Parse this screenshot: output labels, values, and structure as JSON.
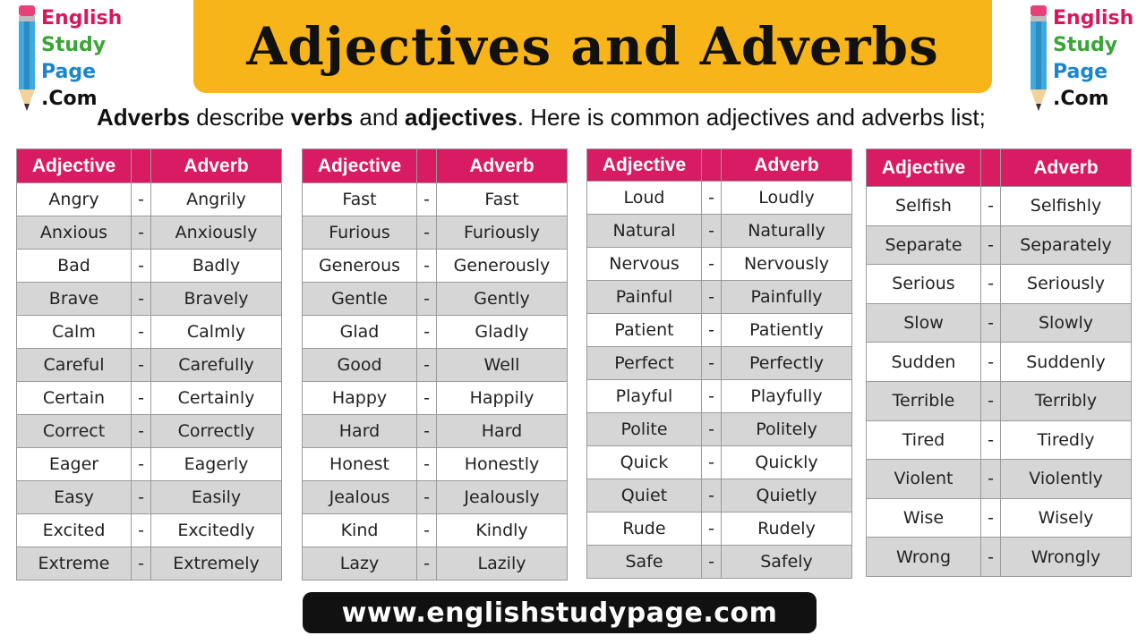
{
  "logo": {
    "line1": "English",
    "line2": "Study",
    "line3": "Page",
    "line4": ".Com"
  },
  "title": "Adjectives and Adverbs",
  "subtitle": {
    "w1": "Adverbs",
    "w2": " describe ",
    "w3": "verbs",
    "w4": " and ",
    "w5": "adjectives",
    "w6": ". Here is common adjectives and adverbs list;"
  },
  "headers": {
    "adjective": "Adjective",
    "adverb": "Adverb",
    "dash": "-"
  },
  "tables": [
    {
      "rows": [
        [
          "Angry",
          "Angrily"
        ],
        [
          "Anxious",
          "Anxiously"
        ],
        [
          "Bad",
          "Badly"
        ],
        [
          "Brave",
          "Bravely"
        ],
        [
          "Calm",
          "Calmly"
        ],
        [
          "Careful",
          "Carefully"
        ],
        [
          "Certain",
          "Certainly"
        ],
        [
          "Correct",
          "Correctly"
        ],
        [
          "Eager",
          "Eagerly"
        ],
        [
          "Easy",
          "Easily"
        ],
        [
          "Excited",
          "Excitedly"
        ],
        [
          "Extreme",
          "Extremely"
        ]
      ]
    },
    {
      "rows": [
        [
          "Fast",
          "Fast"
        ],
        [
          "Furious",
          "Furiously"
        ],
        [
          "Generous",
          "Generously"
        ],
        [
          "Gentle",
          "Gently"
        ],
        [
          "Glad",
          "Gladly"
        ],
        [
          "Good",
          "Well"
        ],
        [
          "Happy",
          "Happily"
        ],
        [
          "Hard",
          "Hard"
        ],
        [
          "Honest",
          "Honestly"
        ],
        [
          "Jealous",
          "Jealously"
        ],
        [
          "Kind",
          "Kindly"
        ],
        [
          "Lazy",
          "Lazily"
        ]
      ]
    },
    {
      "rows": [
        [
          "Loud",
          "Loudly"
        ],
        [
          "Natural",
          "Naturally"
        ],
        [
          "Nervous",
          "Nervously"
        ],
        [
          "Painful",
          "Painfully"
        ],
        [
          "Patient",
          "Patiently"
        ],
        [
          "Perfect",
          "Perfectly"
        ],
        [
          "Playful",
          "Playfully"
        ],
        [
          "Polite",
          "Politely"
        ],
        [
          "Quick",
          "Quickly"
        ],
        [
          "Quiet",
          "Quietly"
        ],
        [
          "Rude",
          "Rudely"
        ],
        [
          "Safe",
          "Safely"
        ]
      ]
    },
    {
      "rows": [
        [
          "Selfish",
          "Selfishly"
        ],
        [
          "Separate",
          "Separately"
        ],
        [
          "Serious",
          "Seriously"
        ],
        [
          "Slow",
          "Slowly"
        ],
        [
          "Sudden",
          "Suddenly"
        ],
        [
          "Terrible",
          "Terribly"
        ],
        [
          "Tired",
          "Tiredly"
        ],
        [
          "Violent",
          "Violently"
        ],
        [
          "Wise",
          "Wisely"
        ],
        [
          "Wrong",
          "Wrongly"
        ]
      ]
    }
  ],
  "footer": "www.englishstudypage.com",
  "colors": {
    "header": "#d81b63",
    "banner": "#f7b519",
    "stripe": "#d6d6d6",
    "footer": "#111111"
  }
}
